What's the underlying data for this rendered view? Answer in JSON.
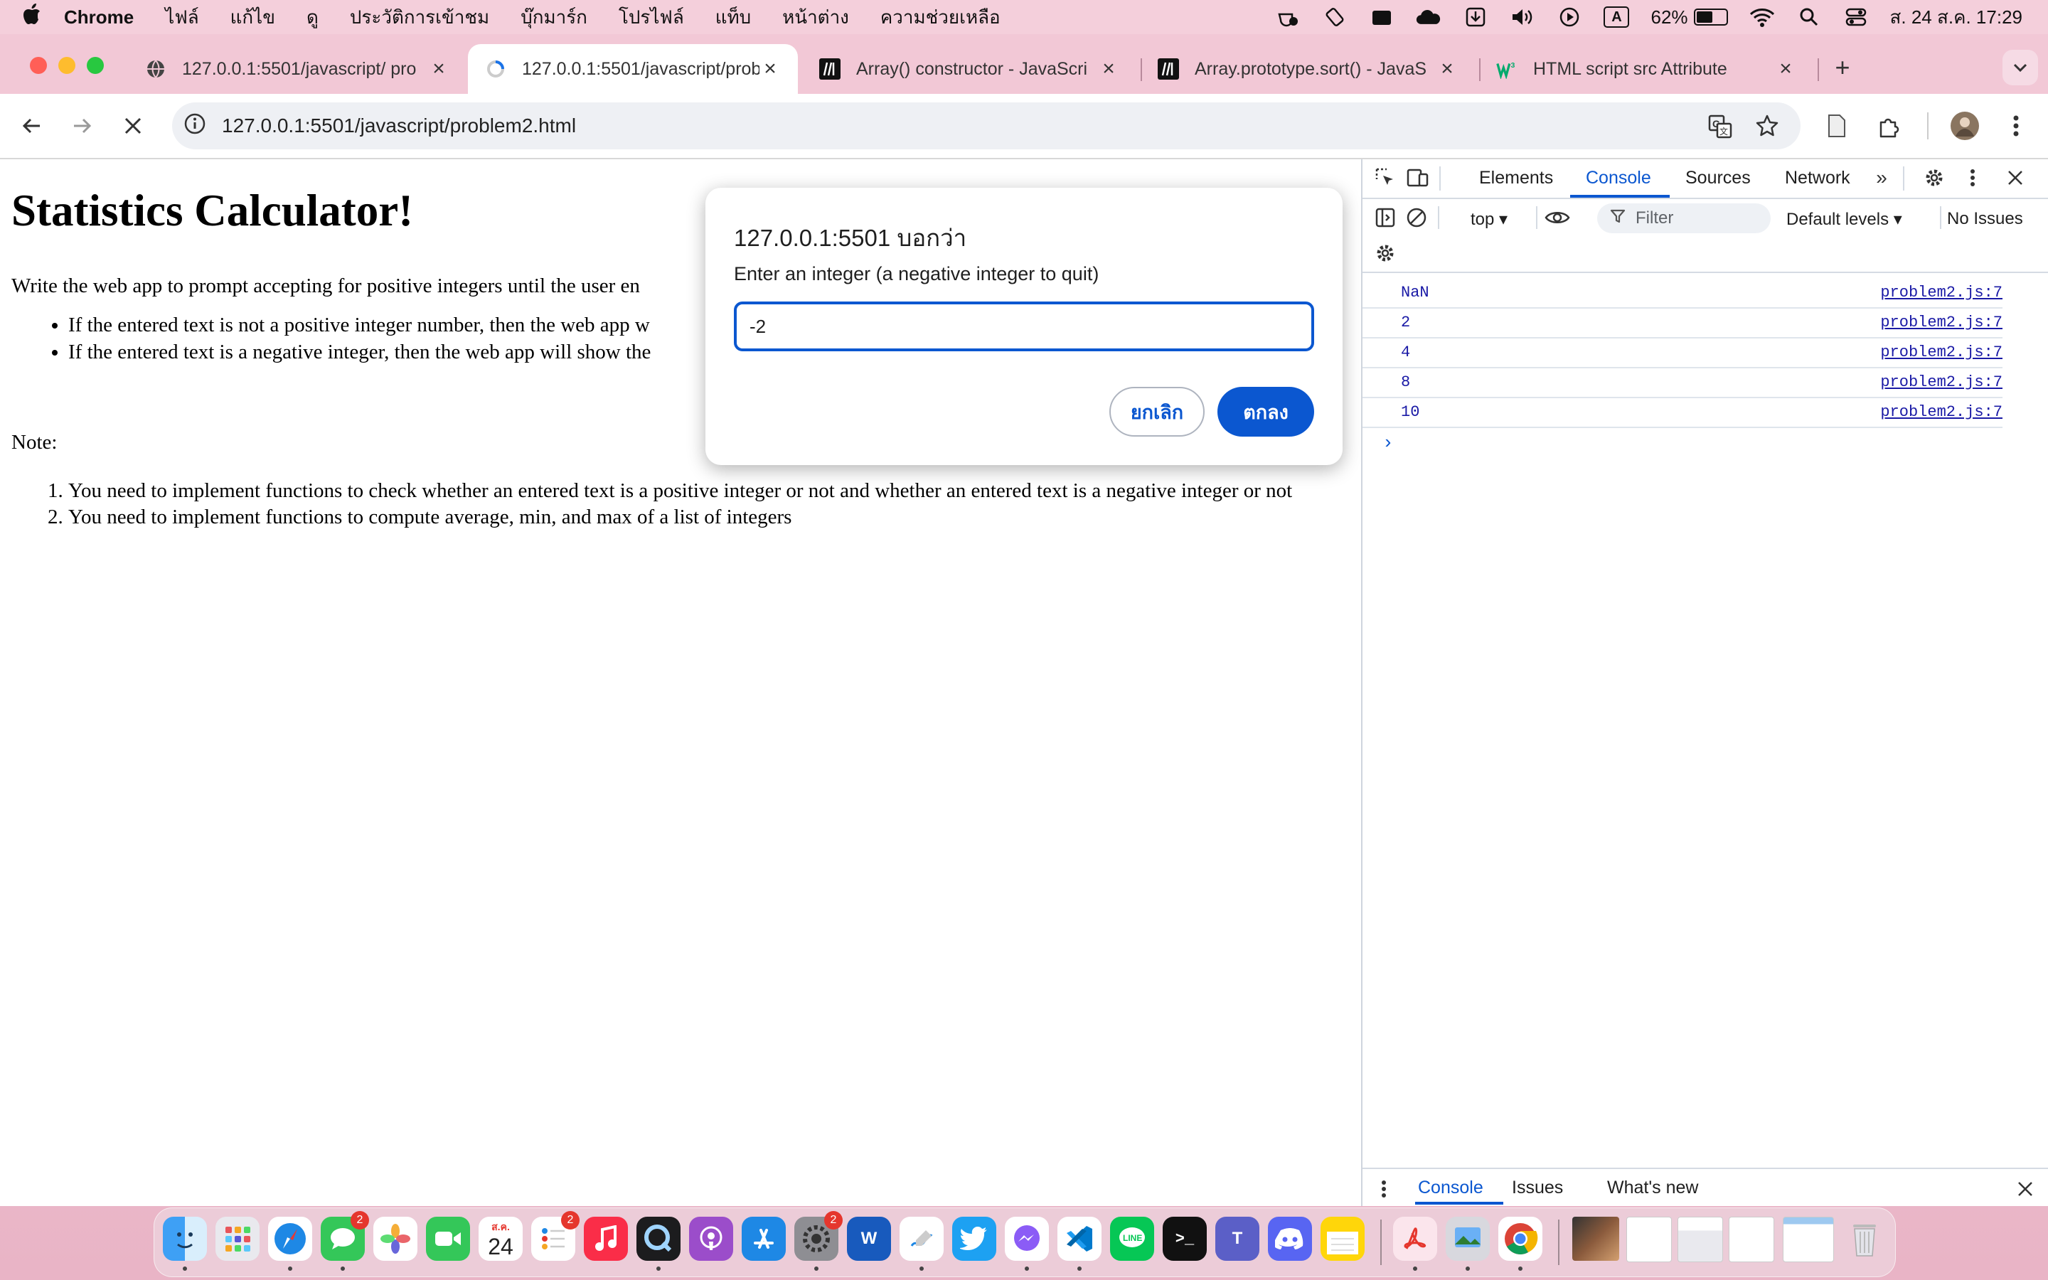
{
  "menubar": {
    "app_name": "Chrome",
    "menus": [
      "ไฟล์",
      "แก้ไข",
      "ดู",
      "ประวัติการเข้าชม",
      "บุ๊กมาร์ก",
      "โปรไฟล์",
      "แท็บ",
      "หน้าต่าง",
      "ความช่วยเหลือ"
    ],
    "input_source": "A",
    "battery_percent": "62%",
    "battery_level": 0.62,
    "datetime": "ส. 24 ส.ค. 17:29"
  },
  "tabs": [
    {
      "title": "127.0.0.1:5501/javascript/ pro",
      "icon": "globe-icon",
      "active": false
    },
    {
      "title": "127.0.0.1:5501/javascript/prob",
      "icon": "loading-icon",
      "active": true
    },
    {
      "title": "Array() constructor - JavaScri",
      "icon": "mdn-icon",
      "active": false
    },
    {
      "title": "Array.prototype.sort() - JavaS",
      "icon": "mdn-icon",
      "active": false
    },
    {
      "title": "HTML script src Attribute",
      "icon": "w3schools-icon",
      "active": false
    }
  ],
  "omnibox": {
    "url": "127.0.0.1:5501/javascript/problem2.html"
  },
  "page": {
    "title": "Statistics Calculator!",
    "intro": "Write the web app to prompt accepting for positive integers until the user en",
    "bullets": [
      "If the entered text is not a positive integer number, then the web app w",
      "If the entered text is a negative integer, then the web app will show the"
    ],
    "note_label": "Note:",
    "notes": [
      "You need to implement functions to check whether an entered text is a positive integer or not and whether an entered text is a negative integer or not",
      "You need to implement functions to compute average, min, and max of a list of integers"
    ]
  },
  "dialog": {
    "title": "127.0.0.1:5501 บอกว่า",
    "message": "Enter an integer (a negative integer to quit)",
    "input_value": "-2",
    "cancel_label": "ยกเลิก",
    "ok_label": "ตกลง"
  },
  "devtools": {
    "tabs": [
      "Elements",
      "Console",
      "Sources",
      "Network"
    ],
    "active_tab": "Console",
    "context": "top",
    "filter_placeholder": "Filter",
    "levels": "Default levels",
    "issues": "No Issues",
    "logs": [
      {
        "value": "NaN",
        "source": "problem2.js:7"
      },
      {
        "value": "2",
        "source": "problem2.js:7"
      },
      {
        "value": "4",
        "source": "problem2.js:7"
      },
      {
        "value": "8",
        "source": "problem2.js:7"
      },
      {
        "value": "10",
        "source": "problem2.js:7"
      }
    ],
    "drawer_tabs": [
      "Console",
      "Issues",
      "What's new"
    ]
  },
  "dock": {
    "calendar_month": "ส.ค.",
    "calendar_day": "24",
    "badges": {
      "messages": "2",
      "reminders": "2",
      "settings": "2"
    }
  }
}
